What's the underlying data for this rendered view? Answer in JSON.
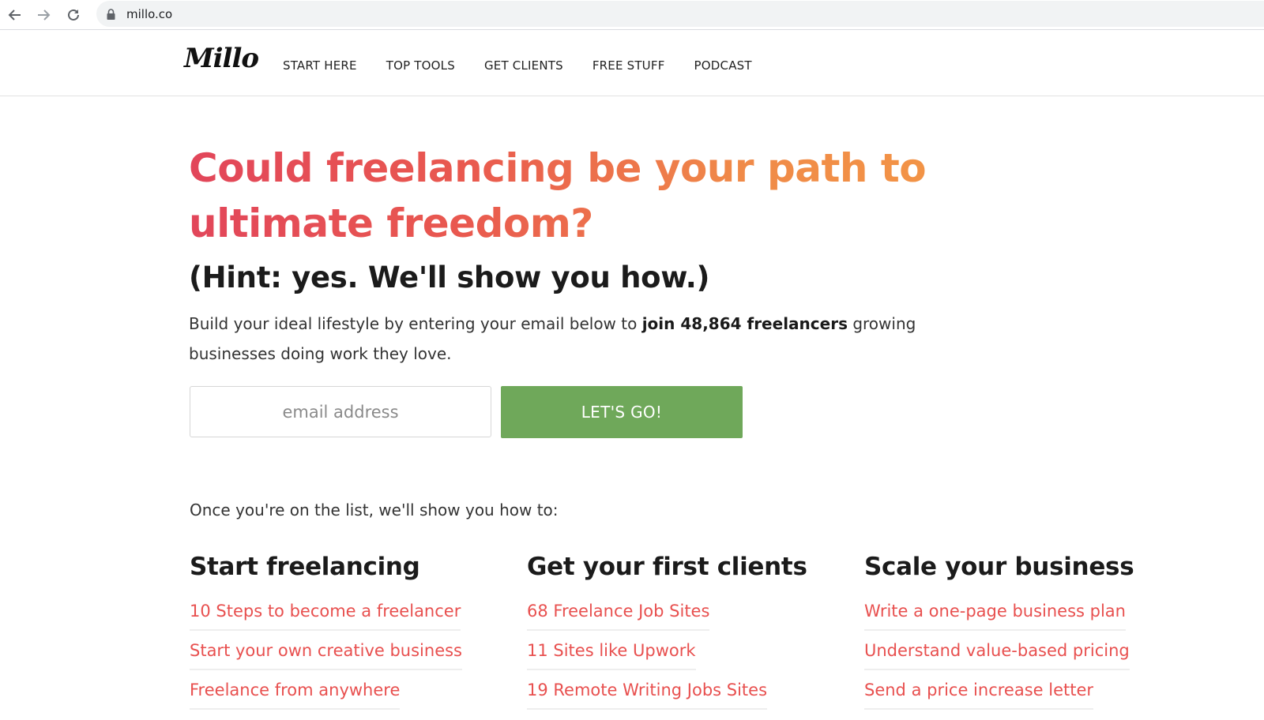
{
  "browser": {
    "url": "millo.co",
    "icons": [
      "back-arrow-icon",
      "forward-arrow-icon",
      "reload-icon",
      "lock-icon"
    ]
  },
  "header": {
    "logo": "Millo",
    "nav": [
      "START HERE",
      "TOP TOOLS",
      "GET CLIENTS",
      "FREE STUFF",
      "PODCAST"
    ]
  },
  "hero": {
    "title": "Could freelancing be your path to ultimate freedom?",
    "hint": "(Hint: yes. We'll show you how.)",
    "intro_before": "Build your ideal lifestyle by entering your email below to ",
    "intro_bold": "join 48,864 freelancers",
    "intro_after": " growing businesses doing work they love.",
    "email_placeholder": "email address",
    "cta": "LET'S GO!",
    "gradient_colors": [
      "#e2465a",
      "#f39646"
    ]
  },
  "list": {
    "intro": "Once you're on the list, we'll show you how to:",
    "columns": [
      {
        "heading": "Start freelancing",
        "links": [
          "10 Steps to become a freelancer",
          "Start your own creative business",
          "Freelance from anywhere"
        ]
      },
      {
        "heading": "Get your first clients",
        "links": [
          "68 Freelance Job Sites",
          "11 Sites like Upwork",
          "19 Remote Writing Jobs Sites"
        ]
      },
      {
        "heading": "Scale your business",
        "links": [
          "Write a one-page business plan",
          "Understand value-based pricing",
          "Send a price increase letter"
        ]
      }
    ]
  },
  "colors": {
    "accent_link": "#e8504f",
    "cta_green": "#6fa85a"
  }
}
